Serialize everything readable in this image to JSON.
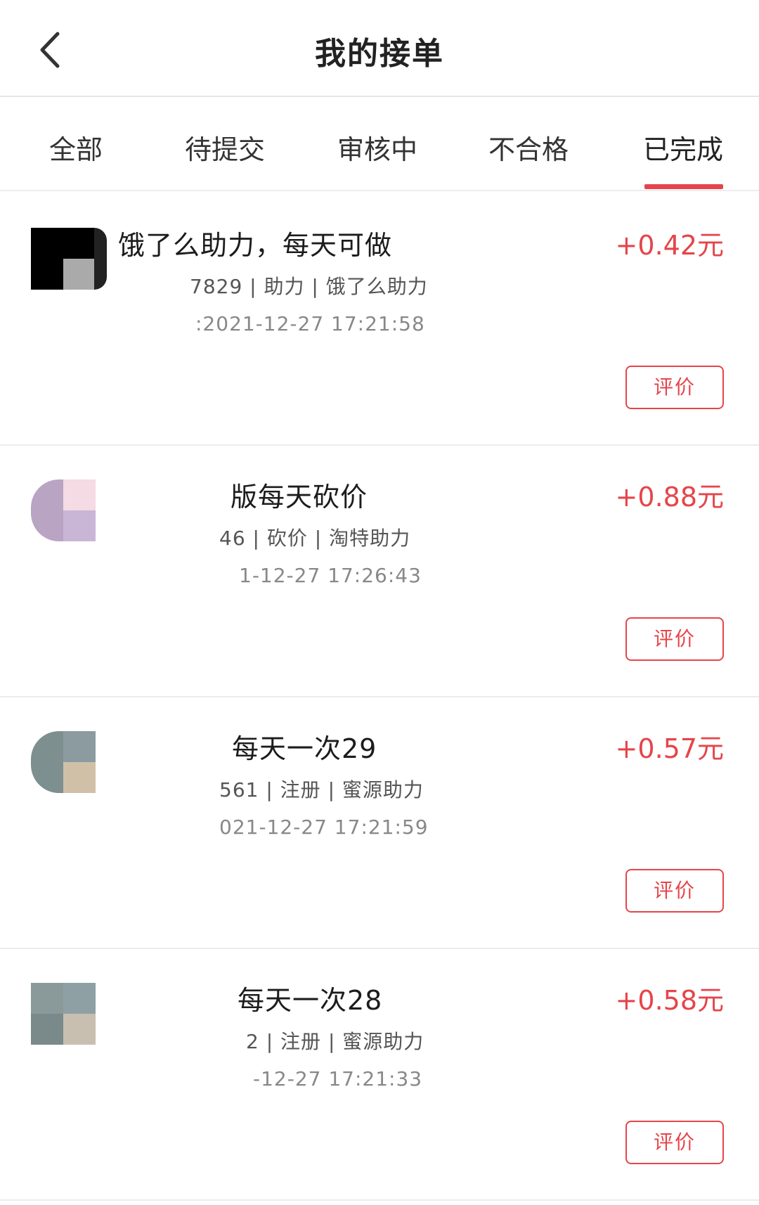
{
  "header": {
    "title": "我的接单"
  },
  "tabs": [
    {
      "label": "全部"
    },
    {
      "label": "待提交"
    },
    {
      "label": "审核中"
    },
    {
      "label": "不合格"
    },
    {
      "label": "已完成"
    }
  ],
  "orders": [
    {
      "title": "饿了么助力，每天可做",
      "meta": "7829 | 助力 | 饿了么助力",
      "time": ":2021-12-27 17:21:58",
      "amount": "+0.42元",
      "button": "评价"
    },
    {
      "title": "版每天砍价",
      "meta": "46 | 砍价 | 淘特助力",
      "time": "1-12-27 17:26:43",
      "amount": "+0.88元",
      "button": "评价"
    },
    {
      "title": "每天一次29",
      "meta": "561 | 注册 | 蜜源助力",
      "time": "021-12-27 17:21:59",
      "amount": "+0.57元",
      "button": "评价"
    },
    {
      "title": "每天一次28",
      "meta": "2 | 注册 | 蜜源助力",
      "time": "-12-27 17:21:33",
      "amount": "+0.58元",
      "button": "评价"
    }
  ],
  "colors": {
    "accent": "#e5454a",
    "text": "#222222",
    "muted": "#888888"
  }
}
